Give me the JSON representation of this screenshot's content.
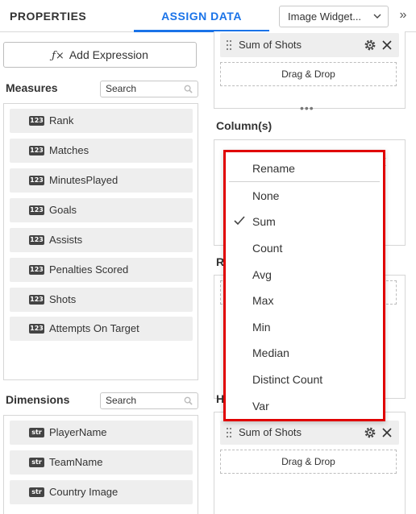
{
  "header": {
    "tab_properties": "PROPERTIES",
    "tab_assign": "ASSIGN DATA",
    "widget_select": "Image Widget...",
    "collapse": "»"
  },
  "left": {
    "add_expression": "Add Expression",
    "measures_title": "Measures",
    "measures_search_placeholder": "Search",
    "measures": [
      "Rank",
      "Matches",
      "MinutesPlayed",
      "Goals",
      "Assists",
      "Penalties Scored",
      "Shots",
      "Attempts On Target"
    ],
    "measure_badge": "123",
    "dimensions_title": "Dimensions",
    "dimensions_search_placeholder": "Search",
    "dimensions": [
      "PlayerName",
      "TeamName",
      "Country Image"
    ],
    "dimension_badge": "str"
  },
  "right": {
    "top_chip": "Sum of Shots",
    "drag_drop": "Drag & Drop",
    "columns_title": "Column(s)",
    "rows_title_partial": "R",
    "hidden_title_partial": "H",
    "bottom_chip": "Sum of Shots",
    "bottom_drag_drop": "Drag & Drop"
  },
  "menu": {
    "items": [
      "Rename",
      "None",
      "Sum",
      "Count",
      "Avg",
      "Max",
      "Min",
      "Median",
      "Distinct Count",
      "Var"
    ],
    "selected": "Sum"
  },
  "colors": {
    "accent": "#1a73e8",
    "highlight_border": "#e00000"
  }
}
